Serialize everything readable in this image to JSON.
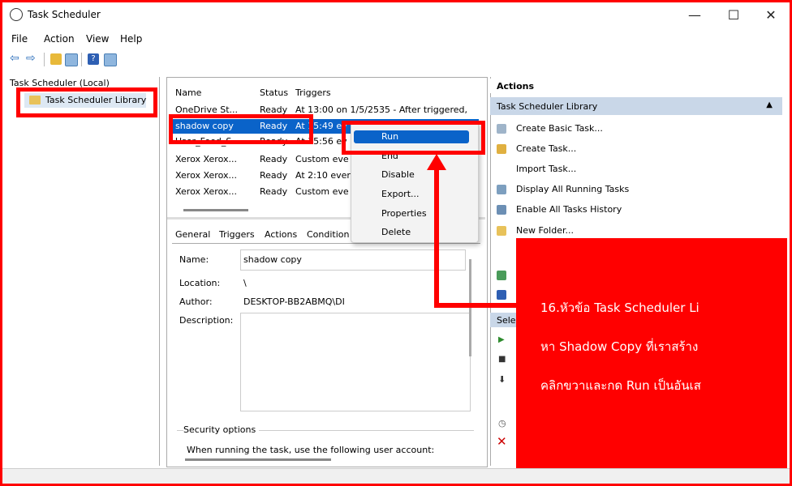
{
  "window": {
    "title": "Task Scheduler",
    "minimize": "—",
    "maximize": "☐",
    "close": "✕"
  },
  "menu": [
    "File",
    "Action",
    "View",
    "Help"
  ],
  "tree": {
    "root": "Task Scheduler (Local)",
    "library": "Task Scheduler Library"
  },
  "task_list": {
    "headers": [
      "Name",
      "Status",
      "Triggers"
    ],
    "rows": [
      {
        "name": "OneDrive St...",
        "status": "Ready",
        "trigger": "At 13:00 on 1/5/2535 - After triggered,"
      },
      {
        "name": "shadow copy",
        "status": "Ready",
        "trigger": "At 15:49 ev"
      },
      {
        "name": "User_Feed_S...",
        "status": "Ready",
        "trigger": "At 15:56 ev"
      },
      {
        "name": "Xerox Xerox...",
        "status": "Ready",
        "trigger": "Custom eve"
      },
      {
        "name": "Xerox Xerox...",
        "status": "Ready",
        "trigger": "At 2:10 every"
      },
      {
        "name": "Xerox Xerox...",
        "status": "Ready",
        "trigger": "Custom eve"
      }
    ]
  },
  "context_menu": [
    "Run",
    "End",
    "Disable",
    "Export...",
    "Properties",
    "Delete"
  ],
  "detail": {
    "tabs": [
      "General",
      "Triggers",
      "Actions",
      "Condition"
    ],
    "name_label": "Name:",
    "name_value": "shadow copy",
    "location_label": "Location:",
    "location_value": "\\",
    "author_label": "Author:",
    "author_value": "DESKTOP-BB2ABMQ\\DI",
    "description_label": "Description:",
    "security_title": "Security options",
    "security_text": "When running the task, use the following user account:"
  },
  "actions": {
    "header": "Actions",
    "section": "Task Scheduler Library",
    "items": [
      "Create Basic Task...",
      "Create Task...",
      "Import Task...",
      "Display All Running Tasks",
      "Enable All Tasks History",
      "New Folder..."
    ],
    "selected_stub": "Sele"
  },
  "annotation": {
    "line1": "16.หัวข้อ Task Scheduler Li",
    "line2": "หา Shadow Copy ที่เราสร้าง",
    "line3": "คลิกขวาและกด Run เป็นอันเส"
  },
  "colors": {
    "highlight": "#ff0000",
    "selection": "#0a63c9"
  }
}
